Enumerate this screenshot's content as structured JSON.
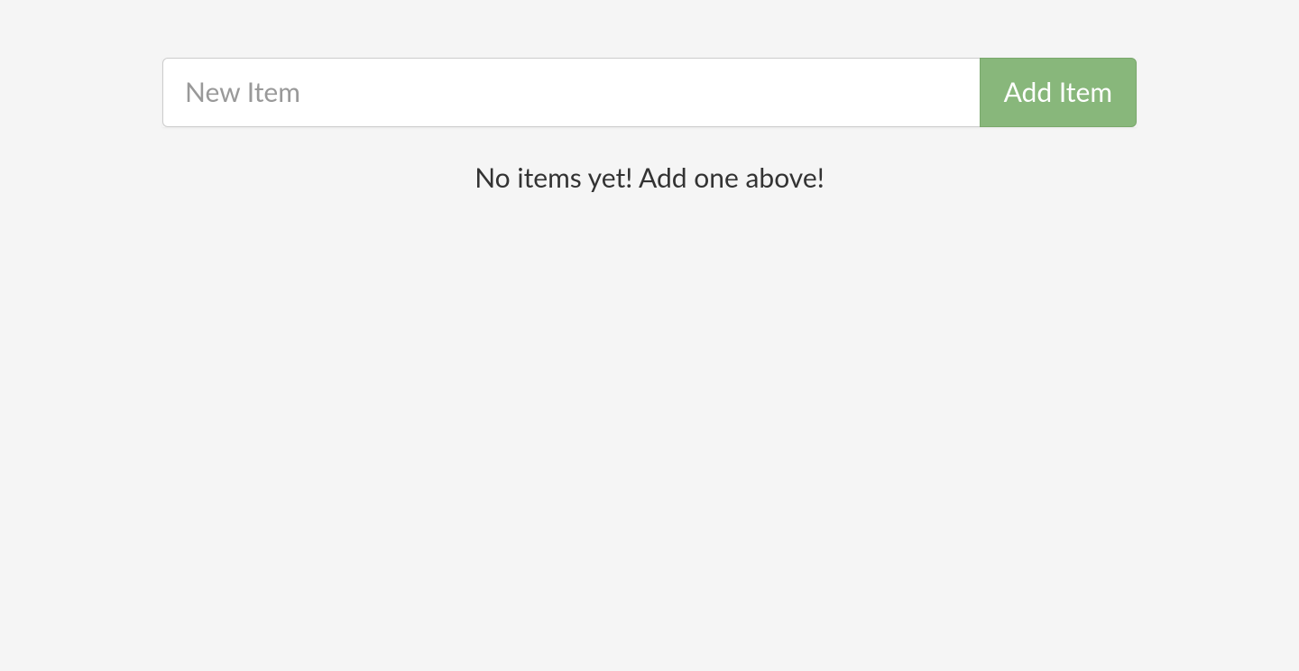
{
  "form": {
    "new_item_placeholder": "New Item",
    "new_item_value": "",
    "add_button_label": "Add Item"
  },
  "empty_state": {
    "message": "No items yet! Add one above!"
  }
}
